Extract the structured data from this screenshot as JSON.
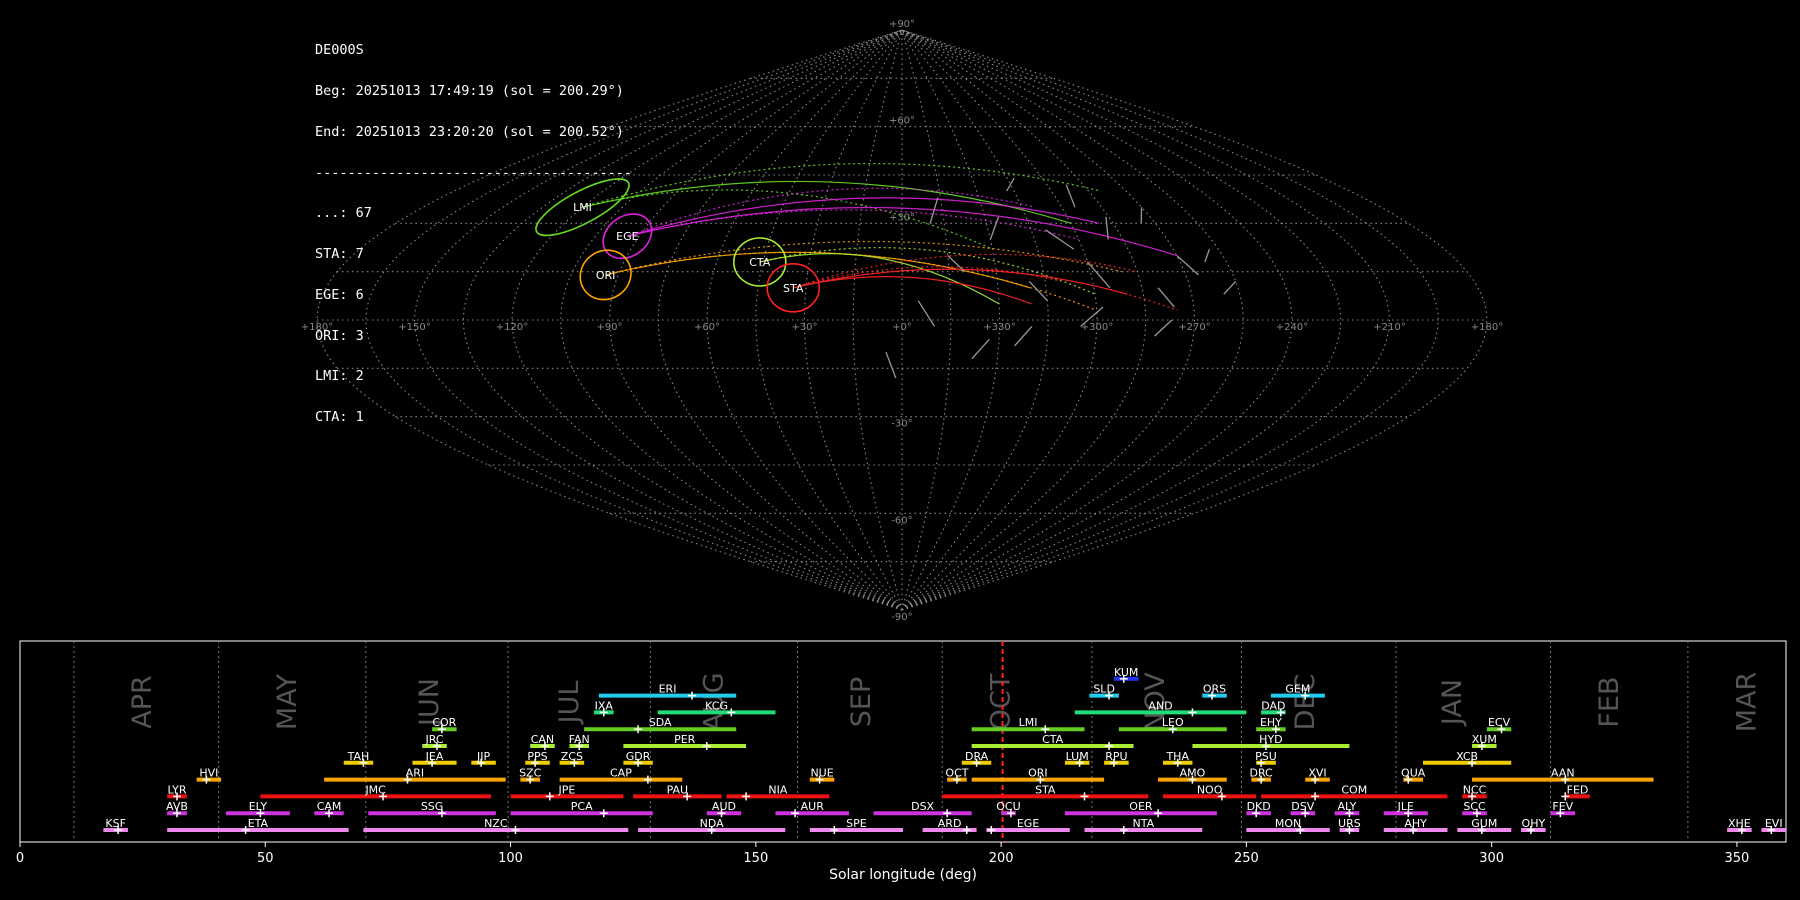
{
  "info": {
    "station": "DE000S",
    "begin": "Beg: 20251013 17:49:19 (sol = 200.29°)",
    "end": "End: 20251013 23:20:20 (sol = 200.52°)",
    "separator": "---------------------------------------",
    "counts": [
      {
        "label": "...: 67"
      },
      {
        "label": "STA: 7"
      },
      {
        "label": "EGE: 6"
      },
      {
        "label": "ORI: 3"
      },
      {
        "label": "LMI: 2"
      },
      {
        "label": "CTA: 1"
      }
    ]
  },
  "sky": {
    "lon_labels": [
      "+180°",
      "+150°",
      "+120°",
      "+90°",
      "+60°",
      "+30°",
      "+0°",
      "+330°",
      "+300°",
      "+270°",
      "+240°",
      "+210°",
      "+180°"
    ],
    "lat_labels": [
      {
        "text": "+90°",
        "lat": 90
      },
      {
        "text": "+60°",
        "lat": 60
      },
      {
        "text": "+30°",
        "lat": 30
      },
      {
        "text": "-30°",
        "lat": -30
      },
      {
        "text": "-60°",
        "lat": -60
      },
      {
        "text": "-90°",
        "lat": -90
      }
    ],
    "showers": [
      {
        "code": "LMI",
        "color": "#66dd22",
        "lon": 120,
        "lat": 35
      },
      {
        "code": "EGE",
        "color": "#dd22dd",
        "lon": 94,
        "lat": 26
      },
      {
        "code": "ORI",
        "color": "#ffa500",
        "lon": 94,
        "lat": 14
      },
      {
        "code": "CTA",
        "color": "#aaee33",
        "lon": 46,
        "lat": 18
      },
      {
        "code": "STA",
        "color": "#ff2222",
        "lon": 34,
        "lat": 10
      }
    ]
  },
  "timeline": {
    "xlabel": "Solar longitude (deg)",
    "xlim": [
      0,
      360
    ],
    "ticks": [
      {
        "v": 0,
        "t": "0"
      },
      {
        "v": 50,
        "t": "50"
      },
      {
        "v": 100,
        "t": "100"
      },
      {
        "v": 150,
        "t": "150"
      },
      {
        "v": 200,
        "t": "200"
      },
      {
        "v": 250,
        "t": "250"
      },
      {
        "v": 300,
        "t": "300"
      },
      {
        "v": 350,
        "t": "350"
      }
    ],
    "current_sol": 200.3,
    "month_lines": [
      11,
      40.5,
      70.5,
      99.5,
      128.5,
      158.5,
      188,
      218.5,
      249,
      280.5,
      312,
      340
    ],
    "months": [
      {
        "t": "APR",
        "v": 25
      },
      {
        "t": "MAY",
        "v": 54.5
      },
      {
        "t": "JUN",
        "v": 83.5
      },
      {
        "t": "JUL",
        "v": 112
      },
      {
        "t": "AUG",
        "v": 141.5
      },
      {
        "t": "SEP",
        "v": 171.5
      },
      {
        "t": "OCT",
        "v": 200
      },
      {
        "t": "NOV",
        "v": 231.5
      },
      {
        "t": "DEC",
        "v": 262
      },
      {
        "t": "JAN",
        "v": 292
      },
      {
        "t": "FEB",
        "v": 324
      },
      {
        "t": "MAR",
        "v": 352
      }
    ],
    "showers": [
      {
        "code": "KSF",
        "s": 17,
        "e": 22,
        "p": 20,
        "row": 0,
        "c": "#ee88ee"
      },
      {
        "code": "ETA",
        "s": 30,
        "e": 67,
        "p": 46,
        "row": 0,
        "c": "#ee88ee"
      },
      {
        "code": "NZC",
        "s": 70,
        "e": 124,
        "p": 101,
        "row": 0,
        "c": "#ee88ee"
      },
      {
        "code": "NDA",
        "s": 126,
        "e": 156,
        "p": 141,
        "row": 0,
        "c": "#ee88ee"
      },
      {
        "code": "SPE",
        "s": 161,
        "e": 180,
        "p": 166,
        "row": 0,
        "c": "#ee88ee"
      },
      {
        "code": "ARD",
        "s": 184,
        "e": 195,
        "p": 193,
        "row": 0,
        "c": "#ee88ee"
      },
      {
        "code": "EGE",
        "s": 197,
        "e": 214,
        "p": 198,
        "row": 0,
        "c": "#ee88ee"
      },
      {
        "code": "NTA",
        "s": 217,
        "e": 241,
        "p": 225,
        "row": 0,
        "c": "#ee88ee"
      },
      {
        "code": "MON",
        "s": 250,
        "e": 267,
        "p": 261,
        "row": 0,
        "c": "#ee88ee"
      },
      {
        "code": "URS",
        "s": 269,
        "e": 273,
        "p": 271,
        "row": 0,
        "c": "#ee88ee"
      },
      {
        "code": "AHY",
        "s": 278,
        "e": 291,
        "p": 284,
        "row": 0,
        "c": "#ee88ee"
      },
      {
        "code": "GUM",
        "s": 293,
        "e": 304,
        "p": 298,
        "row": 0,
        "c": "#ee88ee"
      },
      {
        "code": "OHY",
        "s": 306,
        "e": 311,
        "p": 308,
        "row": 0,
        "c": "#ee88ee"
      },
      {
        "code": "XHE",
        "s": 348,
        "e": 353,
        "p": 351,
        "row": 0,
        "c": "#ee88ee"
      },
      {
        "code": "EVI",
        "s": 355,
        "e": 360,
        "p": 357,
        "row": 0,
        "c": "#ee88ee"
      },
      {
        "code": "AVB",
        "s": 30,
        "e": 34,
        "p": 32,
        "row": 1,
        "c": "#cc33dd"
      },
      {
        "code": "ELY",
        "s": 42,
        "e": 55,
        "p": 49,
        "row": 1,
        "c": "#cc33dd"
      },
      {
        "code": "CAM",
        "s": 60,
        "e": 66,
        "p": 63,
        "row": 1,
        "c": "#cc33dd"
      },
      {
        "code": "SSG",
        "s": 71,
        "e": 97,
        "p": 86,
        "row": 1,
        "c": "#cc33dd"
      },
      {
        "code": "PCA",
        "s": 100,
        "e": 129,
        "p": 119,
        "row": 1,
        "c": "#cc33dd"
      },
      {
        "code": "AUD",
        "s": 140,
        "e": 147,
        "p": 143,
        "row": 1,
        "c": "#cc33dd"
      },
      {
        "code": "AUR",
        "s": 154,
        "e": 169,
        "p": 158,
        "row": 1,
        "c": "#cc33dd"
      },
      {
        "code": "DSX",
        "s": 174,
        "e": 194,
        "p": 189,
        "row": 1,
        "c": "#cc33dd"
      },
      {
        "code": "OCU",
        "s": 200,
        "e": 203,
        "p": 202,
        "row": 1,
        "c": "#cc33dd"
      },
      {
        "code": "OER",
        "s": 213,
        "e": 244,
        "p": 232,
        "row": 1,
        "c": "#cc33dd"
      },
      {
        "code": "DKD",
        "s": 250,
        "e": 255,
        "p": 252,
        "row": 1,
        "c": "#cc33dd"
      },
      {
        "code": "DSV",
        "s": 259,
        "e": 264,
        "p": 262,
        "row": 1,
        "c": "#cc33dd"
      },
      {
        "code": "ALY",
        "s": 268,
        "e": 273,
        "p": 271,
        "row": 1,
        "c": "#cc33dd"
      },
      {
        "code": "JLE",
        "s": 278,
        "e": 287,
        "p": 283,
        "row": 1,
        "c": "#cc33dd"
      },
      {
        "code": "SCC",
        "s": 294,
        "e": 299,
        "p": 297,
        "row": 1,
        "c": "#cc33dd"
      },
      {
        "code": "FEV",
        "s": 312,
        "e": 317,
        "p": 314,
        "row": 1,
        "c": "#cc33dd"
      },
      {
        "code": "LYR",
        "s": 30,
        "e": 34,
        "p": 32,
        "row": 2,
        "c": "#ee1111"
      },
      {
        "code": "JMC",
        "s": 49,
        "e": 96,
        "p": 74,
        "row": 2,
        "c": "#ee1111"
      },
      {
        "code": "JPE",
        "s": 100,
        "e": 123,
        "p": 108,
        "row": 2,
        "c": "#ee1111"
      },
      {
        "code": "PAU",
        "s": 125,
        "e": 143,
        "p": 136,
        "row": 2,
        "c": "#ee1111"
      },
      {
        "code": "NIA",
        "s": 144,
        "e": 165,
        "p": 148,
        "row": 2,
        "c": "#ee1111"
      },
      {
        "code": "STA",
        "s": 188,
        "e": 230,
        "p": 217,
        "row": 2,
        "c": "#ee1111"
      },
      {
        "code": "NOO",
        "s": 233,
        "e": 252,
        "p": 245,
        "row": 2,
        "c": "#ee1111"
      },
      {
        "code": "COM",
        "s": 253,
        "e": 291,
        "p": 264,
        "row": 2,
        "c": "#ee1111"
      },
      {
        "code": "NCC",
        "s": 294,
        "e": 299,
        "p": 296,
        "row": 2,
        "c": "#ee1111"
      },
      {
        "code": "FED",
        "s": 315,
        "e": 320,
        "p": 315,
        "row": 2,
        "c": "#ee1111"
      },
      {
        "code": "HVI",
        "s": 36,
        "e": 41,
        "p": 38,
        "row": 3,
        "c": "#ffa500"
      },
      {
        "code": "ARI",
        "s": 62,
        "e": 99,
        "p": 79,
        "row": 3,
        "c": "#ffa500"
      },
      {
        "code": "SZC",
        "s": 102,
        "e": 106,
        "p": 104,
        "row": 3,
        "c": "#ffa500"
      },
      {
        "code": "CAP",
        "s": 110,
        "e": 135,
        "p": 128,
        "row": 3,
        "c": "#ffa500"
      },
      {
        "code": "NUE",
        "s": 161,
        "e": 166,
        "p": 163,
        "row": 3,
        "c": "#ffa500"
      },
      {
        "code": "OCT",
        "s": 189,
        "e": 193,
        "p": 191,
        "row": 3,
        "c": "#ffa500"
      },
      {
        "code": "ORI",
        "s": 194,
        "e": 221,
        "p": 208,
        "row": 3,
        "c": "#ffa500"
      },
      {
        "code": "AMO",
        "s": 232,
        "e": 246,
        "p": 239,
        "row": 3,
        "c": "#ffa500"
      },
      {
        "code": "DRC",
        "s": 251,
        "e": 255,
        "p": 253,
        "row": 3,
        "c": "#ffa500"
      },
      {
        "code": "XVI",
        "s": 262,
        "e": 267,
        "p": 264,
        "row": 3,
        "c": "#ffa500"
      },
      {
        "code": "QUA",
        "s": 282,
        "e": 286,
        "p": 283,
        "row": 3,
        "c": "#ffa500"
      },
      {
        "code": "AAN",
        "s": 296,
        "e": 333,
        "p": 315,
        "row": 3,
        "c": "#ffa500"
      },
      {
        "code": "TAH",
        "s": 66,
        "e": 72,
        "p": 70,
        "row": 4,
        "c": "#eecc00"
      },
      {
        "code": "JEA",
        "s": 80,
        "e": 89,
        "p": 84,
        "row": 4,
        "c": "#eecc00"
      },
      {
        "code": "JIP",
        "s": 92,
        "e": 97,
        "p": 94,
        "row": 4,
        "c": "#eecc00"
      },
      {
        "code": "PPS",
        "s": 103,
        "e": 108,
        "p": 105,
        "row": 4,
        "c": "#eecc00"
      },
      {
        "code": "ZCS",
        "s": 110,
        "e": 115,
        "p": 113,
        "row": 4,
        "c": "#eecc00"
      },
      {
        "code": "GDR",
        "s": 123,
        "e": 129,
        "p": 126,
        "row": 4,
        "c": "#eecc00"
      },
      {
        "code": "DRA",
        "s": 192,
        "e": 198,
        "p": 195,
        "row": 4,
        "c": "#eecc00"
      },
      {
        "code": "LUM",
        "s": 213,
        "e": 218,
        "p": 216,
        "row": 4,
        "c": "#eecc00"
      },
      {
        "code": "RPU",
        "s": 221,
        "e": 226,
        "p": 223,
        "row": 4,
        "c": "#eecc00"
      },
      {
        "code": "THA",
        "s": 233,
        "e": 239,
        "p": 236,
        "row": 4,
        "c": "#eecc00"
      },
      {
        "code": "PSU",
        "s": 252,
        "e": 256,
        "p": 253,
        "row": 4,
        "c": "#eecc00"
      },
      {
        "code": "XCB",
        "s": 286,
        "e": 304,
        "p": 296,
        "row": 4,
        "c": "#eecc00"
      },
      {
        "code": "JRC",
        "s": 82,
        "e": 87,
        "p": 85,
        "row": 5,
        "c": "#aaee33"
      },
      {
        "code": "CAN",
        "s": 104,
        "e": 109,
        "p": 107,
        "row": 5,
        "c": "#aaee33"
      },
      {
        "code": "FAN",
        "s": 112,
        "e": 116,
        "p": 114,
        "row": 5,
        "c": "#aaee33"
      },
      {
        "code": "PER",
        "s": 123,
        "e": 148,
        "p": 140,
        "row": 5,
        "c": "#aaee33"
      },
      {
        "code": "CTA",
        "s": 194,
        "e": 227,
        "p": 222,
        "row": 5,
        "c": "#aaee33"
      },
      {
        "code": "HYD",
        "s": 239,
        "e": 271,
        "p": 254,
        "row": 5,
        "c": "#aaee33"
      },
      {
        "code": "XUM",
        "s": 296,
        "e": 301,
        "p": 298,
        "row": 5,
        "c": "#aaee33"
      },
      {
        "code": "COR",
        "s": 84,
        "e": 89,
        "p": 86,
        "row": 6,
        "c": "#66cc22"
      },
      {
        "code": "SDA",
        "s": 115,
        "e": 146,
        "p": 126,
        "row": 6,
        "c": "#66cc22"
      },
      {
        "code": "LMI",
        "s": 194,
        "e": 217,
        "p": 209,
        "row": 6,
        "c": "#66cc22"
      },
      {
        "code": "LEO",
        "s": 224,
        "e": 246,
        "p": 235,
        "row": 6,
        "c": "#66cc22"
      },
      {
        "code": "EHY",
        "s": 252,
        "e": 258,
        "p": 256,
        "row": 6,
        "c": "#66cc22"
      },
      {
        "code": "ECV",
        "s": 299,
        "e": 304,
        "p": 302,
        "row": 6,
        "c": "#66cc22"
      },
      {
        "code": "IXA",
        "s": 117,
        "e": 121,
        "p": 119,
        "row": 7,
        "c": "#22dd77"
      },
      {
        "code": "KCG",
        "s": 130,
        "e": 154,
        "p": 145,
        "row": 7,
        "c": "#22dd77"
      },
      {
        "code": "AND",
        "s": 215,
        "e": 250,
        "p": 239,
        "row": 7,
        "c": "#22dd77"
      },
      {
        "code": "DAD",
        "s": 253,
        "e": 258,
        "p": 257,
        "row": 7,
        "c": "#22dd77"
      },
      {
        "code": "ERI",
        "s": 118,
        "e": 146,
        "p": 137,
        "row": 8,
        "c": "#22ccee"
      },
      {
        "code": "SLD",
        "s": 218,
        "e": 224,
        "p": 222,
        "row": 8,
        "c": "#22ccee"
      },
      {
        "code": "ORS",
        "s": 241,
        "e": 246,
        "p": 243,
        "row": 8,
        "c": "#22ccee"
      },
      {
        "code": "GEM",
        "s": 255,
        "e": 266,
        "p": 262,
        "row": 8,
        "c": "#22ccee"
      },
      {
        "code": "KUM",
        "s": 223,
        "e": 228,
        "p": 225,
        "row": 9,
        "c": "#2233ee"
      }
    ]
  }
}
